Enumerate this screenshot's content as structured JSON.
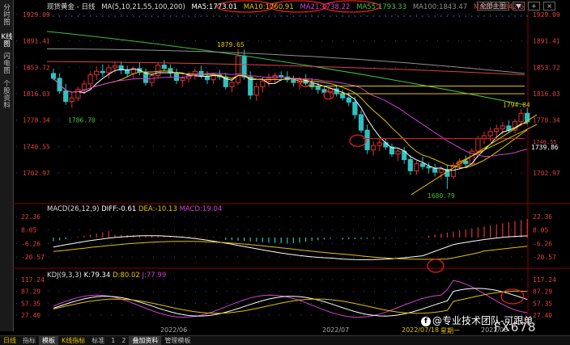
{
  "side_tabs": [
    {
      "label": "分时图",
      "active": false
    },
    {
      "label": "K线图",
      "active": true
    },
    {
      "label": "闪电图",
      "active": false
    },
    {
      "label": "个股资料",
      "active": false
    }
  ],
  "legend": {
    "symbol": "现货黄金 - 日线",
    "ma_title": "MA(5,10,21,55,100,200)",
    "ma5": "MA5:1773.01",
    "ma10": "MA10:1760.91",
    "ma21": "MA21:1738.22",
    "ma55": "MA55:1793.33",
    "ma100": "MA100:1843.47",
    "ma200": "MA200:1842.6"
  },
  "colors": {
    "ma5": "#ffffff",
    "ma10": "#e6c200",
    "ma21": "#d040d0",
    "ma55": "#40c040",
    "ma100": "#909090",
    "ma200": "#e04040",
    "up": "#e03030",
    "down": "#30c0c0",
    "axis_text": "#e04040",
    "highlight": "#e02020"
  },
  "top_right": {
    "label": "全部主图",
    "btn1": "▼",
    "btn2": "+",
    "btn3": "×"
  },
  "price_axis_labels": [
    "1929.09",
    "1891.41",
    "1853.72",
    "1816.03",
    "1778.34",
    "1740.55",
    "1702.97"
  ],
  "price_axis_values": [
    1929.09,
    1891.41,
    1853.72,
    1816.03,
    1778.34,
    1740.55,
    1702.97
  ],
  "price_annotations": {
    "high1": "1879.65",
    "low1": "1786.70",
    "low2": "1680.79",
    "high2": "1794.84",
    "current": "1739.86",
    "right_1740": "1740.55"
  },
  "macd": {
    "title": "MACD(26,12,9)",
    "diff": "DIFF:-0.61",
    "dea": "DEA:-10.13",
    "macd": "MACD:19.04",
    "axis_labels": [
      "22.36",
      "8.05",
      "-6.26",
      "-20.57"
    ],
    "axis_values": [
      22.36,
      8.05,
      -6.26,
      -20.57
    ]
  },
  "kdj": {
    "title": "KDJ(9,3,3)",
    "k": "K:79.34",
    "d": "D:80.02",
    "j": "J:77.99",
    "axis_labels": [
      "117.24",
      "87.29",
      "57.35",
      "27.40"
    ],
    "axis_values": [
      117.24,
      87.29,
      57.35,
      27.4
    ]
  },
  "date_axis": [
    "2022/06",
    "2022/07",
    "2022/07/18",
    "星期一",
    "2022/08"
  ],
  "bottom_tabs": [
    {
      "label": "日线",
      "style": "yellow"
    },
    {
      "label": "指标",
      "style": ""
    },
    {
      "label": "模板",
      "style": "active"
    },
    {
      "label": "K线指标",
      "style": "yellow"
    },
    {
      "label": "标准",
      "style": ""
    },
    {
      "label": "1",
      "style": ""
    },
    {
      "label": "2",
      "style": ""
    },
    {
      "label": "叠加资料",
      "style": "active"
    },
    {
      "label": "管理模板",
      "style": ""
    }
  ],
  "watermark": {
    "text": "@专业技术团队-可跟单",
    "logo": "FX678"
  },
  "candles": [
    {
      "o": 1845,
      "h": 1852,
      "l": 1835,
      "c": 1838
    },
    {
      "o": 1838,
      "h": 1845,
      "l": 1816,
      "c": 1820
    },
    {
      "o": 1820,
      "h": 1830,
      "l": 1800,
      "c": 1805
    },
    {
      "o": 1805,
      "h": 1818,
      "l": 1796,
      "c": 1810
    },
    {
      "o": 1810,
      "h": 1826,
      "l": 1805,
      "c": 1822
    },
    {
      "o": 1822,
      "h": 1835,
      "l": 1815,
      "c": 1830
    },
    {
      "o": 1830,
      "h": 1848,
      "l": 1825,
      "c": 1843
    },
    {
      "o": 1843,
      "h": 1855,
      "l": 1836,
      "c": 1848
    },
    {
      "o": 1848,
      "h": 1858,
      "l": 1840,
      "c": 1846
    },
    {
      "o": 1846,
      "h": 1858,
      "l": 1838,
      "c": 1853
    },
    {
      "o": 1853,
      "h": 1862,
      "l": 1846,
      "c": 1856
    },
    {
      "o": 1856,
      "h": 1862,
      "l": 1844,
      "c": 1850
    },
    {
      "o": 1850,
      "h": 1856,
      "l": 1840,
      "c": 1845
    },
    {
      "o": 1845,
      "h": 1855,
      "l": 1838,
      "c": 1852
    },
    {
      "o": 1852,
      "h": 1860,
      "l": 1842,
      "c": 1847
    },
    {
      "o": 1847,
      "h": 1852,
      "l": 1828,
      "c": 1832
    },
    {
      "o": 1832,
      "h": 1845,
      "l": 1826,
      "c": 1842
    },
    {
      "o": 1842,
      "h": 1860,
      "l": 1838,
      "c": 1857
    },
    {
      "o": 1857,
      "h": 1864,
      "l": 1848,
      "c": 1852
    },
    {
      "o": 1852,
      "h": 1858,
      "l": 1840,
      "c": 1846
    },
    {
      "o": 1846,
      "h": 1852,
      "l": 1830,
      "c": 1835
    },
    {
      "o": 1835,
      "h": 1842,
      "l": 1826,
      "c": 1838
    },
    {
      "o": 1838,
      "h": 1848,
      "l": 1832,
      "c": 1842
    },
    {
      "o": 1842,
      "h": 1852,
      "l": 1836,
      "c": 1848
    },
    {
      "o": 1848,
      "h": 1856,
      "l": 1838,
      "c": 1841
    },
    {
      "o": 1841,
      "h": 1848,
      "l": 1830,
      "c": 1836
    },
    {
      "o": 1836,
      "h": 1846,
      "l": 1830,
      "c": 1843
    },
    {
      "o": 1843,
      "h": 1850,
      "l": 1836,
      "c": 1840
    },
    {
      "o": 1840,
      "h": 1846,
      "l": 1822,
      "c": 1826
    },
    {
      "o": 1826,
      "h": 1838,
      "l": 1818,
      "c": 1832
    },
    {
      "o": 1832,
      "h": 1880,
      "l": 1828,
      "c": 1870
    },
    {
      "o": 1870,
      "h": 1879,
      "l": 1836,
      "c": 1840
    },
    {
      "o": 1840,
      "h": 1848,
      "l": 1808,
      "c": 1814
    },
    {
      "o": 1814,
      "h": 1832,
      "l": 1806,
      "c": 1826
    },
    {
      "o": 1826,
      "h": 1840,
      "l": 1818,
      "c": 1834
    },
    {
      "o": 1834,
      "h": 1845,
      "l": 1826,
      "c": 1838
    },
    {
      "o": 1838,
      "h": 1846,
      "l": 1830,
      "c": 1842
    },
    {
      "o": 1842,
      "h": 1848,
      "l": 1834,
      "c": 1840
    },
    {
      "o": 1840,
      "h": 1848,
      "l": 1832,
      "c": 1836
    },
    {
      "o": 1836,
      "h": 1842,
      "l": 1826,
      "c": 1832
    },
    {
      "o": 1832,
      "h": 1840,
      "l": 1822,
      "c": 1836
    },
    {
      "o": 1836,
      "h": 1844,
      "l": 1828,
      "c": 1831
    },
    {
      "o": 1831,
      "h": 1838,
      "l": 1822,
      "c": 1826
    },
    {
      "o": 1826,
      "h": 1832,
      "l": 1816,
      "c": 1822
    },
    {
      "o": 1822,
      "h": 1828,
      "l": 1812,
      "c": 1818
    },
    {
      "o": 1818,
      "h": 1826,
      "l": 1808,
      "c": 1823
    },
    {
      "o": 1823,
      "h": 1828,
      "l": 1812,
      "c": 1816
    },
    {
      "o": 1816,
      "h": 1822,
      "l": 1806,
      "c": 1810
    },
    {
      "o": 1810,
      "h": 1818,
      "l": 1798,
      "c": 1804
    },
    {
      "o": 1804,
      "h": 1812,
      "l": 1780,
      "c": 1786
    },
    {
      "o": 1786,
      "h": 1792,
      "l": 1760,
      "c": 1764
    },
    {
      "o": 1764,
      "h": 1772,
      "l": 1730,
      "c": 1736
    },
    {
      "o": 1736,
      "h": 1748,
      "l": 1728,
      "c": 1742
    },
    {
      "o": 1742,
      "h": 1752,
      "l": 1734,
      "c": 1746
    },
    {
      "o": 1746,
      "h": 1752,
      "l": 1736,
      "c": 1740
    },
    {
      "o": 1740,
      "h": 1745,
      "l": 1726,
      "c": 1730
    },
    {
      "o": 1730,
      "h": 1738,
      "l": 1720,
      "c": 1734
    },
    {
      "o": 1734,
      "h": 1740,
      "l": 1716,
      "c": 1722
    },
    {
      "o": 1722,
      "h": 1728,
      "l": 1700,
      "c": 1706
    },
    {
      "o": 1706,
      "h": 1720,
      "l": 1700,
      "c": 1716
    },
    {
      "o": 1716,
      "h": 1726,
      "l": 1708,
      "c": 1712
    },
    {
      "o": 1712,
      "h": 1718,
      "l": 1702,
      "c": 1710
    },
    {
      "o": 1710,
      "h": 1716,
      "l": 1698,
      "c": 1704
    },
    {
      "o": 1704,
      "h": 1712,
      "l": 1694,
      "c": 1708
    },
    {
      "o": 1708,
      "h": 1714,
      "l": 1680,
      "c": 1698
    },
    {
      "o": 1698,
      "h": 1718,
      "l": 1694,
      "c": 1714
    },
    {
      "o": 1714,
      "h": 1724,
      "l": 1708,
      "c": 1720
    },
    {
      "o": 1720,
      "h": 1728,
      "l": 1712,
      "c": 1716
    },
    {
      "o": 1716,
      "h": 1738,
      "l": 1714,
      "c": 1734
    },
    {
      "o": 1734,
      "h": 1756,
      "l": 1730,
      "c": 1752
    },
    {
      "o": 1752,
      "h": 1762,
      "l": 1744,
      "c": 1756
    },
    {
      "o": 1756,
      "h": 1768,
      "l": 1748,
      "c": 1762
    },
    {
      "o": 1762,
      "h": 1772,
      "l": 1754,
      "c": 1766
    },
    {
      "o": 1766,
      "h": 1776,
      "l": 1758,
      "c": 1770
    },
    {
      "o": 1770,
      "h": 1778,
      "l": 1760,
      "c": 1764
    },
    {
      "o": 1764,
      "h": 1780,
      "l": 1760,
      "c": 1776
    },
    {
      "o": 1776,
      "h": 1794,
      "l": 1770,
      "c": 1788
    },
    {
      "o": 1788,
      "h": 1796,
      "l": 1772,
      "c": 1776
    }
  ]
}
